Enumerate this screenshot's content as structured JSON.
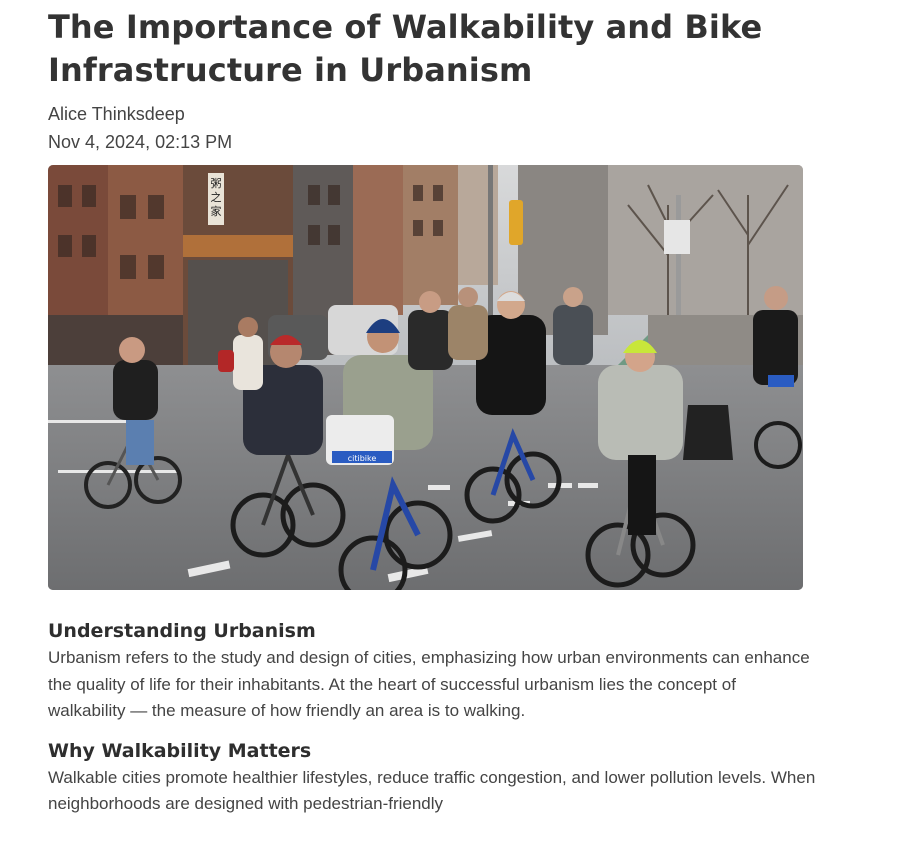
{
  "article": {
    "title": "The Importance of Walkability and Bike Infrastructure in Urbanism",
    "author": "Alice Thinksdeep",
    "date": "Nov 4, 2024, 02:13 PM"
  },
  "hero_image": {
    "sign_left": "粥之家",
    "basket_label": "citibike"
  },
  "sections": [
    {
      "heading": "Understanding Urbanism",
      "body": "Urbanism refers to the study and design of cities, emphasizing how urban environments can enhance the quality of life for their inhabitants. At the heart of successful urbanism lies the concept of walkability — the measure of how friendly an area is to walking."
    },
    {
      "heading": "Why Walkability Matters",
      "body": "Walkable cities promote healthier lifestyles, reduce traffic congestion, and lower pollution levels. When neighborhoods are designed with pedestrian-friendly"
    }
  ]
}
